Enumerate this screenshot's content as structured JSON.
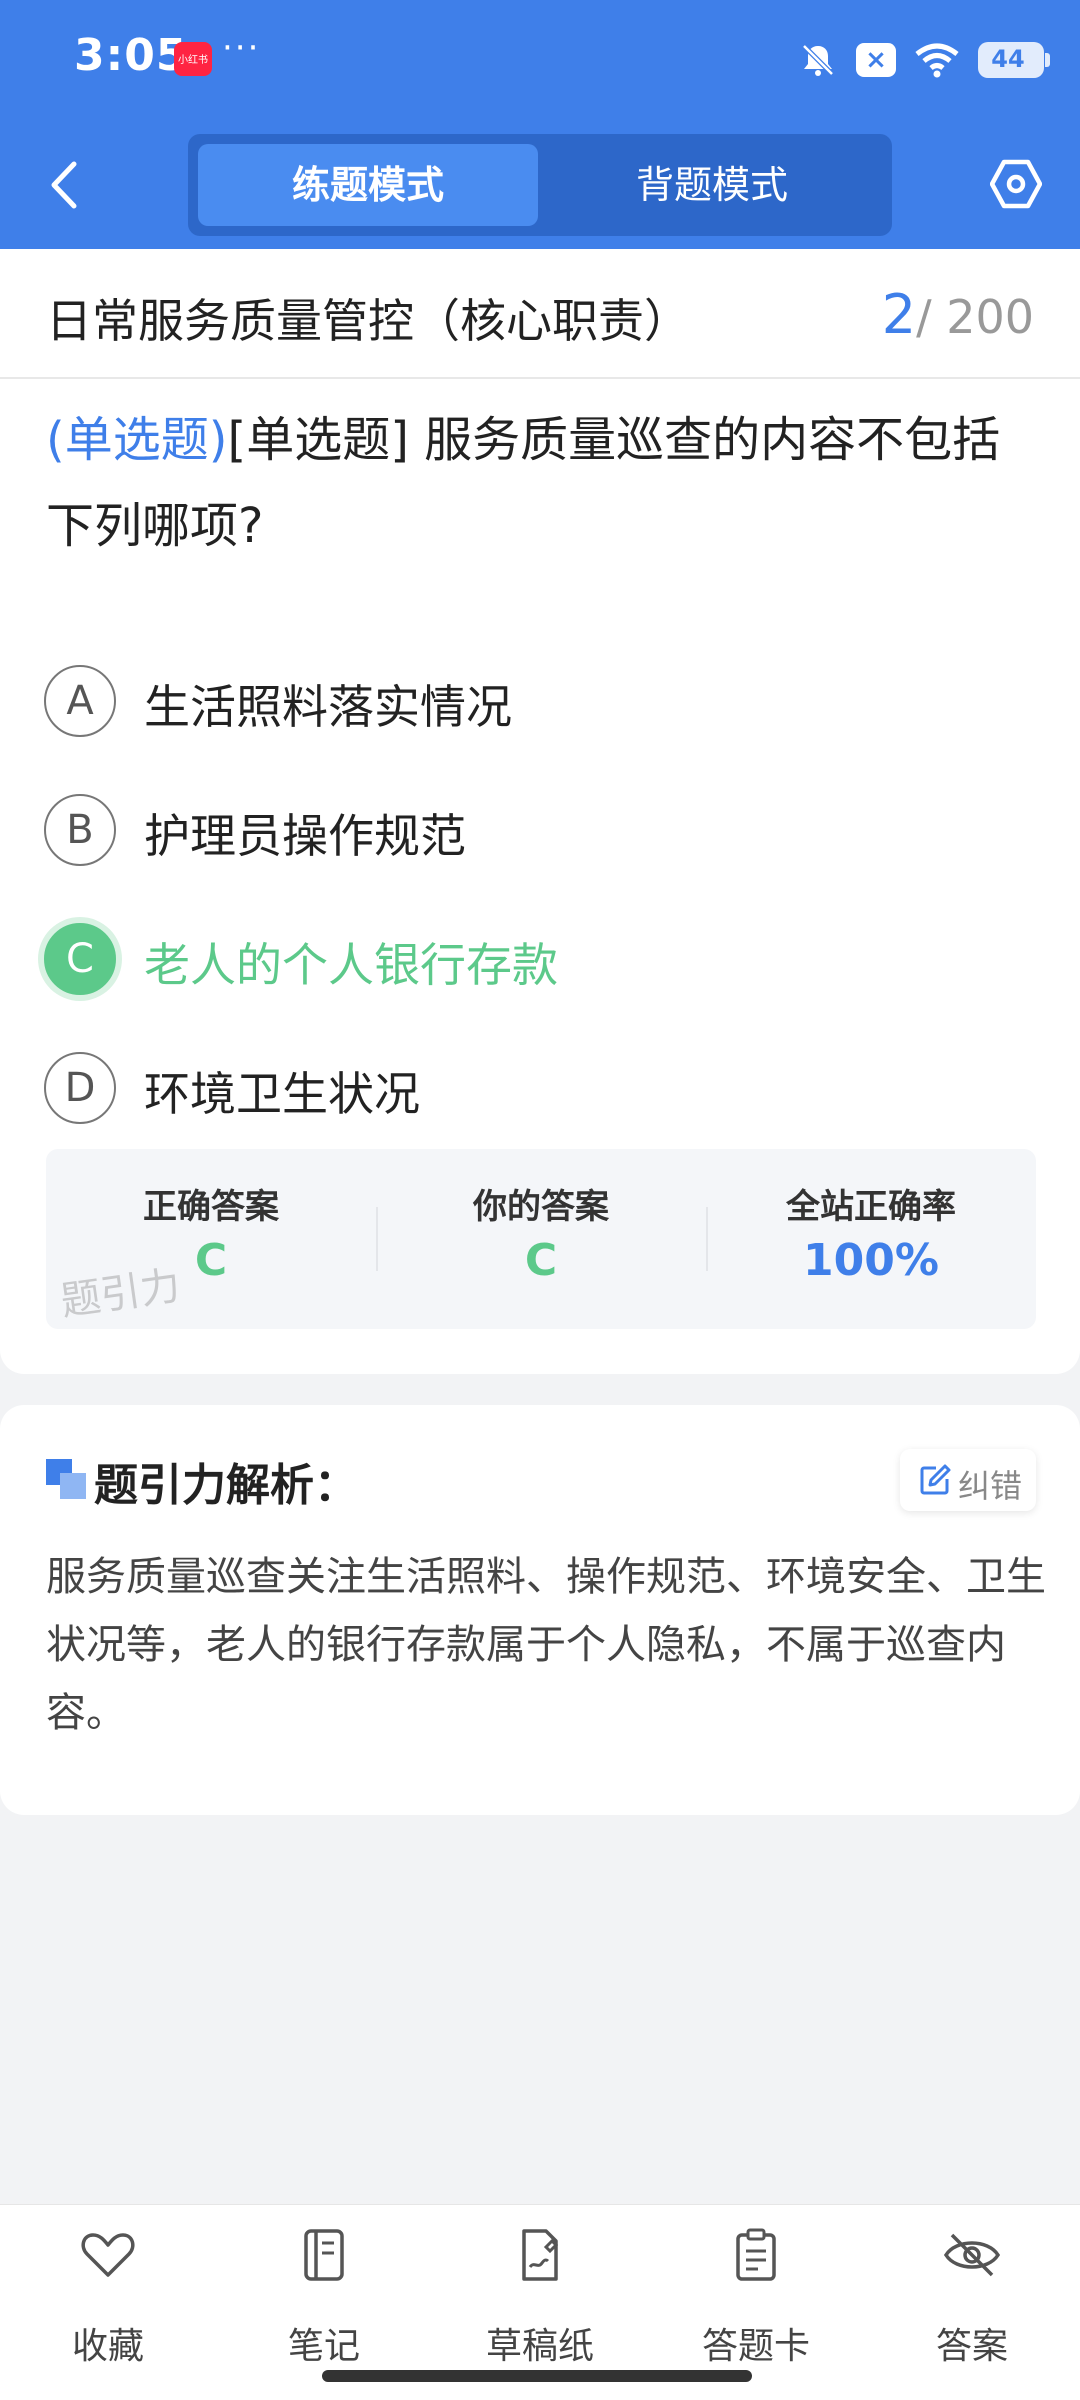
{
  "status_bar": {
    "time": "3:05",
    "app_badge": "小红书",
    "more": "···",
    "battery": "44"
  },
  "header": {
    "tabs": [
      {
        "label": "练题模式",
        "active": true
      },
      {
        "label": "背题模式",
        "active": false
      }
    ]
  },
  "quiz": {
    "section_title": "日常服务质量管控（核心职责）",
    "current": "2",
    "total": "/ 200",
    "question_type": "(单选题)",
    "question_text": "[单选题] 服务质量巡查的内容不包括下列哪项?",
    "options": [
      {
        "letter": "A",
        "text": "生活照料落实情况"
      },
      {
        "letter": "B",
        "text": "护理员操作规范"
      },
      {
        "letter": "C",
        "text": "老人的个人银行存款"
      },
      {
        "letter": "D",
        "text": "环境卫生状况"
      }
    ],
    "selected": "C"
  },
  "answer_summary": {
    "correct_label": "正确答案",
    "correct_value": "C",
    "yours_label": "你的答案",
    "yours_value": "C",
    "rate_label": "全站正确率",
    "rate_value": "100%",
    "watermark": "题引力"
  },
  "explanation": {
    "title": "题引力解析：",
    "report_label": "纠错",
    "body": "服务质量巡查关注生活照料、操作规范、环境安全、卫生状况等，老人的银行存款属于个人隐私，不属于巡查内容。"
  },
  "bottom_nav": [
    {
      "label": "收藏",
      "icon": "heart-icon"
    },
    {
      "label": "笔记",
      "icon": "notebook-icon"
    },
    {
      "label": "草稿纸",
      "icon": "draft-icon"
    },
    {
      "label": "答题卡",
      "icon": "answer-card-icon"
    },
    {
      "label": "答案",
      "icon": "eye-off-icon"
    }
  ],
  "colors": {
    "primary": "#3f7fe9",
    "correct": "#5cc98a",
    "background": "#f2f3f5"
  }
}
